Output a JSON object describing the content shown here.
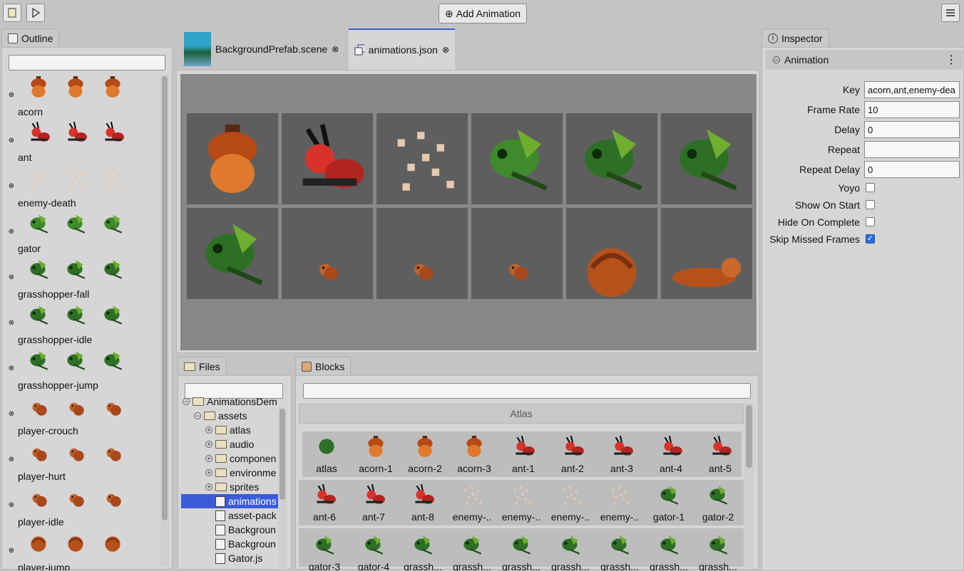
{
  "toolbar": {
    "add_animation": "Add Animation"
  },
  "outline": {
    "tab": "Outline",
    "items": [
      {
        "label": "acorn",
        "color": "#c2571e"
      },
      {
        "label": "ant",
        "color": "#d8322a"
      },
      {
        "label": "enemy-death",
        "color": "#e7c9b0"
      },
      {
        "label": "gator",
        "color": "#3e8a2c"
      },
      {
        "label": "grasshopper-fall",
        "color": "#2e6f26"
      },
      {
        "label": "grasshopper-idle",
        "color": "#2e6f26"
      },
      {
        "label": "grasshopper-jump",
        "color": "#2e6f26"
      },
      {
        "label": "player-crouch",
        "color": "#c0632a"
      },
      {
        "label": "player-hurt",
        "color": "#c0632a"
      },
      {
        "label": "player-idle",
        "color": "#c0632a"
      },
      {
        "label": "player-jump",
        "color": "#c0632a"
      }
    ]
  },
  "editor": {
    "tabs": [
      {
        "label": "BackgroundPrefab.scene"
      },
      {
        "label": "animations.json"
      }
    ]
  },
  "files": {
    "tab": "Files",
    "rows": [
      {
        "label": "AnimationsDem",
        "indent": 0,
        "kind": "folder",
        "exp": "⊖"
      },
      {
        "label": "assets",
        "indent": 1,
        "kind": "folder",
        "exp": "⊖"
      },
      {
        "label": "atlas",
        "indent": 2,
        "kind": "folder",
        "exp": "⊕"
      },
      {
        "label": "audio",
        "indent": 2,
        "kind": "folder",
        "exp": "⊕"
      },
      {
        "label": "componen",
        "indent": 2,
        "kind": "folder",
        "exp": "⊕"
      },
      {
        "label": "environme",
        "indent": 2,
        "kind": "folder",
        "exp": "⊕"
      },
      {
        "label": "sprites",
        "indent": 2,
        "kind": "folder",
        "exp": "⊕"
      },
      {
        "label": "animations",
        "indent": 2,
        "kind": "file",
        "exp": ""
      },
      {
        "label": "asset-pack",
        "indent": 2,
        "kind": "file",
        "exp": ""
      },
      {
        "label": "Backgroun",
        "indent": 2,
        "kind": "file",
        "exp": ""
      },
      {
        "label": "Backgroun",
        "indent": 2,
        "kind": "file",
        "exp": ""
      },
      {
        "label": "Gator.js",
        "indent": 2,
        "kind": "file",
        "exp": ""
      }
    ]
  },
  "blocks": {
    "tab": "Blocks",
    "section": "Atlas",
    "rows": [
      [
        "atlas",
        "acorn-1",
        "acorn-2",
        "acorn-3",
        "ant-1",
        "ant-2",
        "ant-3",
        "ant-4",
        "ant-5"
      ],
      [
        "ant-6",
        "ant-7",
        "ant-8",
        "enemy-..",
        "enemy-..",
        "enemy-..",
        "enemy-..",
        "gator-1",
        "gator-2"
      ],
      [
        "gator-3",
        "gator-4",
        "grassh...",
        "grassh...",
        "grassh...",
        "grassh...",
        "grassh...",
        "grassh...",
        "grassh..."
      ]
    ]
  },
  "inspector": {
    "tab": "Inspector",
    "section": "Animation",
    "fields": [
      {
        "key": "Key",
        "value": "acorn,ant,enemy-dea"
      },
      {
        "key": "Frame Rate",
        "value": "10"
      },
      {
        "key": "Delay",
        "value": "0"
      },
      {
        "key": "Repeat",
        "value": ""
      },
      {
        "key": "Repeat Delay",
        "value": "0"
      }
    ],
    "checks": [
      {
        "key": "Yoyo",
        "checked": false
      },
      {
        "key": "Show On Start",
        "checked": false
      },
      {
        "key": "Hide On Complete",
        "checked": false
      },
      {
        "key": "Skip Missed Frames",
        "checked": true
      }
    ]
  }
}
